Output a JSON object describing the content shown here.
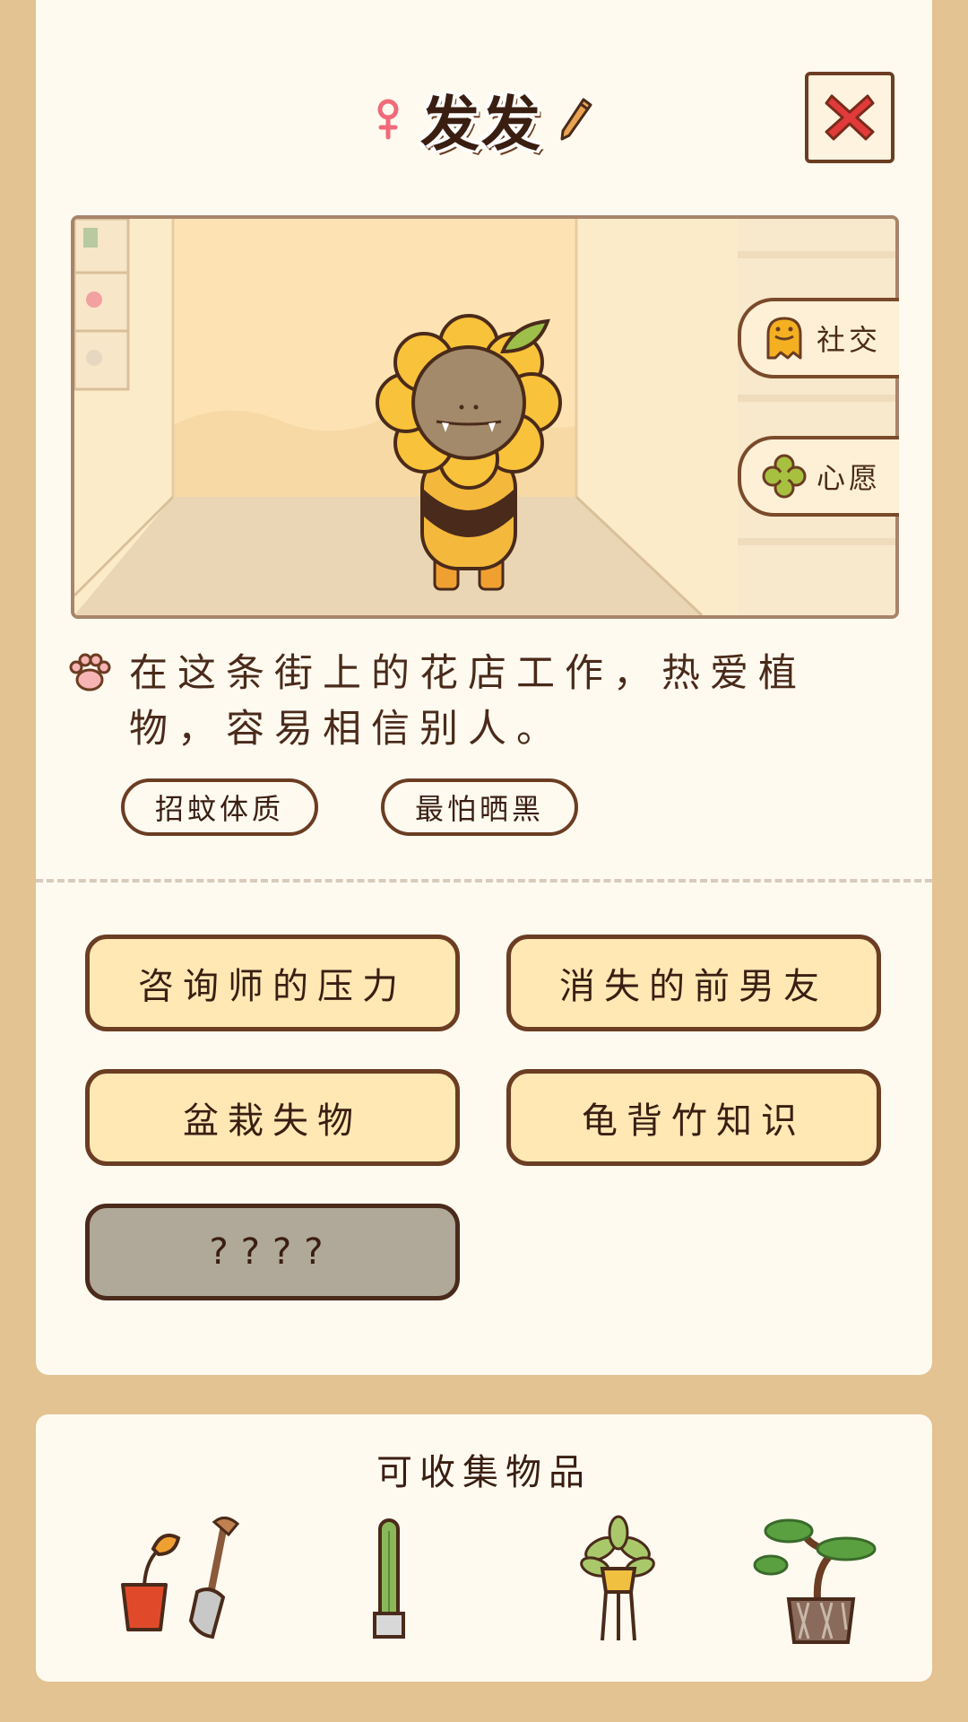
{
  "header": {
    "name": "发发",
    "gender_icon": "female-icon",
    "edit_icon": "pencil-icon",
    "close_icon": "close-icon"
  },
  "scene": {
    "side_buttons": [
      {
        "label": "社交",
        "icon": "monster-face-icon"
      },
      {
        "label": "心愿",
        "icon": "clover-icon"
      }
    ]
  },
  "profile": {
    "description": "在这条街上的花店工作，热爱植物，容易相信别人。",
    "tags": [
      "招蚊体质",
      "最怕晒黑"
    ]
  },
  "stories": [
    {
      "label": "咨询师的压力",
      "locked": false
    },
    {
      "label": "消失的前男友",
      "locked": false
    },
    {
      "label": "盆栽失物",
      "locked": false
    },
    {
      "label": "龟背竹知识",
      "locked": false
    },
    {
      "label": "????",
      "locked": true
    }
  ],
  "collectibles": {
    "title": "可收集物品",
    "items": [
      "flower-pot-shovel-icon",
      "cactus-icon",
      "hanging-plant-icon",
      "bonsai-icon"
    ]
  },
  "colors": {
    "background": "#e3c392",
    "card": "#fffaf0",
    "button_fill": "#ffe8b4",
    "border": "#6b3d22",
    "locked_fill": "#b0a898",
    "close_x": "#e03a3a"
  }
}
